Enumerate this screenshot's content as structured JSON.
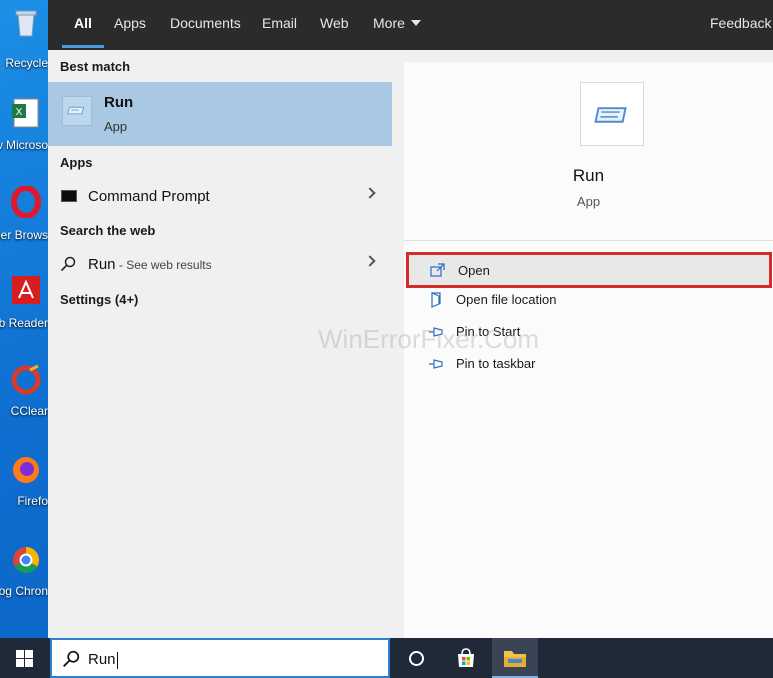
{
  "desktop": {
    "icons": [
      {
        "label": "Recycle",
        "icon": "recycle-bin-icon"
      },
      {
        "label": "New Microso",
        "icon": "excel-icon"
      },
      {
        "label": "Oper Brows",
        "icon": "opera-icon"
      },
      {
        "label": "Acrob Reader",
        "icon": "acrobat-icon"
      },
      {
        "label": "CClear",
        "icon": "ccleaner-icon"
      },
      {
        "label": "Firefo",
        "icon": "firefox-icon"
      },
      {
        "label": "Goog Chron",
        "icon": "chrome-icon"
      }
    ]
  },
  "tabs": [
    {
      "label": "All",
      "active": true
    },
    {
      "label": "Apps"
    },
    {
      "label": "Documents"
    },
    {
      "label": "Email"
    },
    {
      "label": "Web"
    },
    {
      "label": "More"
    }
  ],
  "feedback_label": "Feedback",
  "left": {
    "best_match_heading": "Best match",
    "best_match": {
      "title": "Run",
      "subtitle": "App"
    },
    "apps_heading": "Apps",
    "apps": [
      {
        "label": "Command Prompt",
        "icon": "command-prompt-icon"
      }
    ],
    "web_heading": "Search the web",
    "web": {
      "query": "Run",
      "suffix": " - See web results"
    },
    "settings_heading": "Settings (4+)"
  },
  "right": {
    "title": "Run",
    "subtitle": "App",
    "actions": [
      {
        "label": "Open",
        "icon": "open-icon",
        "highlighted": true
      },
      {
        "label": "Open file location",
        "icon": "file-location-icon"
      },
      {
        "label": "Pin to Start",
        "icon": "pin-icon"
      },
      {
        "label": "Pin to taskbar",
        "icon": "pin-icon"
      }
    ]
  },
  "watermark": "WinErrorFixer.Com",
  "taskbar": {
    "search_value": "Run",
    "items": [
      "windows-start-icon",
      "cortana-icon",
      "store-icon",
      "file-explorer-icon"
    ]
  },
  "colors": {
    "accent": "#0078d7",
    "highlight_outline": "#d42b2b",
    "best_match_bg": "#a8c8e4",
    "topbar_bg": "#2b2b2b",
    "taskbar_bg": "#1f2937"
  }
}
